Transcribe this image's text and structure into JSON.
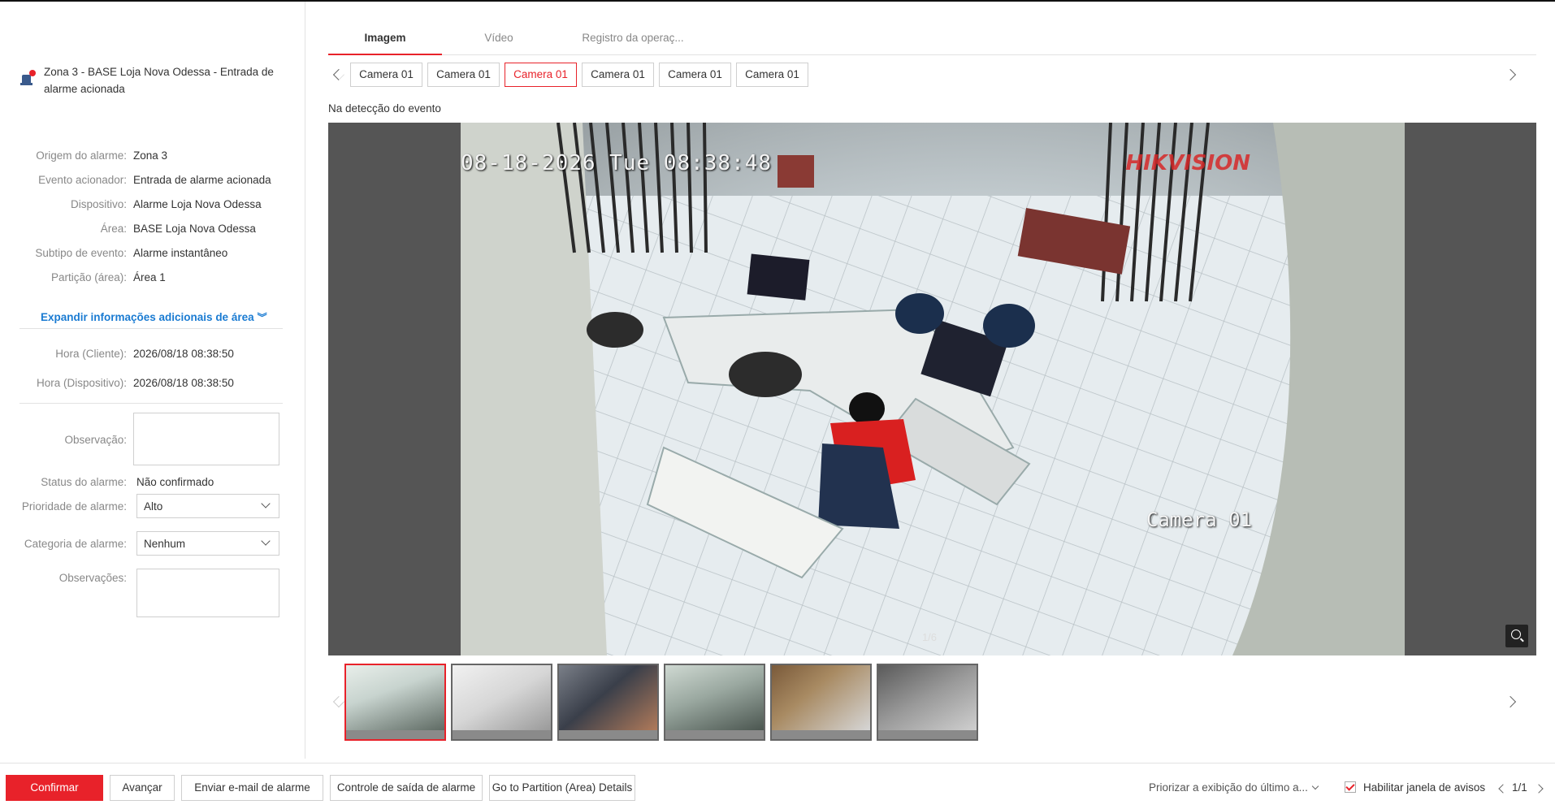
{
  "alarm": {
    "title": "Zona 3 - BASE Loja Nova Odessa - Entrada de alarme acionada"
  },
  "details": [
    {
      "label": "Origem do alarme:",
      "value": "Zona 3"
    },
    {
      "label": "Evento acionador:",
      "value": "Entrada de alarme acionada"
    },
    {
      "label": "Dispositivo:",
      "value": "Alarme Loja Nova Odessa"
    },
    {
      "label": "Área:",
      "value": "BASE Loja Nova Odessa"
    },
    {
      "label": "Subtipo de evento:",
      "value": "Alarme instantâneo"
    },
    {
      "label": "Partição (área):",
      "value": "Área 1"
    }
  ],
  "expand_link": "Expandir informações adicionais de área",
  "times": [
    {
      "label": "Hora (Cliente):",
      "value": "2026/08/18 08:38:50"
    },
    {
      "label": "Hora (Dispositivo):",
      "value": "2026/08/18 08:38:50"
    }
  ],
  "form": {
    "observacao_label": "Observação:",
    "status_label": "Status do alarme:",
    "status_value": "Não confirmado",
    "prioridade_label": "Prioridade de alarme:",
    "prioridade_value": "Alto",
    "categoria_label": "Categoria de alarme:",
    "categoria_value": "Nenhum",
    "observacoes_label": "Observações:"
  },
  "tabs": [
    "Imagem",
    "Vídeo",
    "Registro da operaç..."
  ],
  "cameras": [
    "Camera 01",
    "Camera 01",
    "Camera 01",
    "Camera 01",
    "Camera 01",
    "Camera 01"
  ],
  "selected_camera_index": 2,
  "caption": "Na detecção do evento",
  "viewer": {
    "timestamp_overlay": "08-18-2026 Tue 08:38:48",
    "brand_overlay": "HIKVISION",
    "camera_overlay": "Camera 01",
    "counter": "1/6"
  },
  "thumbnails_count": 6,
  "footer": {
    "confirm": "Confirmar",
    "advance": "Avançar",
    "email": "Enviar e-mail de alarme",
    "output": "Controle de saída de alarme",
    "partition": "Go to Partition (Area) Details",
    "priority": "Priorizar a exibição do último a...",
    "enable_window": "Habilitar janela de avisos",
    "pager": "1/1"
  },
  "colors": {
    "accent": "#e8222a",
    "link": "#1a7bd2"
  }
}
